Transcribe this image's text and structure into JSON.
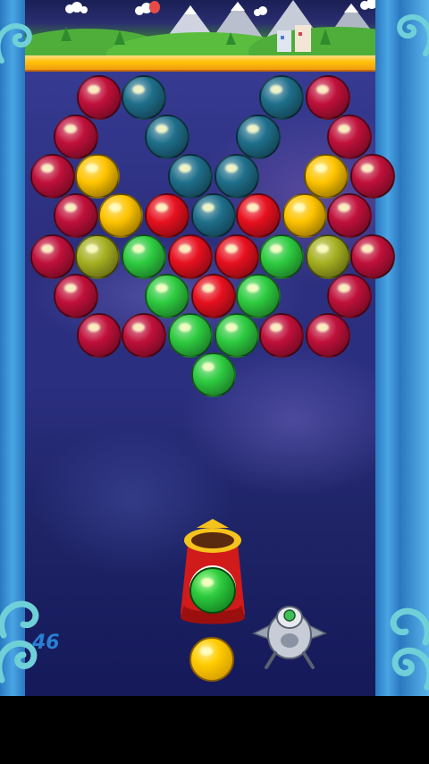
{
  "game": {
    "shots_remaining": "46",
    "current_bubble_color": "#2ecc40",
    "next_bubble_color": "#ffcc00"
  },
  "palette": {
    "red": "#e8101f",
    "magenta": "#c0103a",
    "teal": "#1f6f8b",
    "yellow": "#ffc400",
    "olive": "#a6b020",
    "green": "#2ecc40"
  },
  "board": {
    "rows": [
      [
        "magenta",
        "teal",
        null,
        null,
        "teal",
        "magenta"
      ],
      [
        "magenta",
        "teal",
        null,
        "teal",
        "magenta"
      ],
      [
        "magenta",
        "yellow",
        "teal",
        "teal",
        "yellow",
        "magenta"
      ],
      [
        "magenta",
        "yellow",
        "red",
        "teal",
        "red",
        "yellow",
        "magenta"
      ],
      [
        "magenta",
        "olive",
        "green",
        "red",
        "red",
        "green",
        "olive",
        "magenta"
      ],
      [
        "magenta",
        "green",
        "red",
        "green",
        "magenta"
      ],
      [
        "magenta",
        "magenta",
        "green",
        "green",
        "magenta",
        "magenta"
      ],
      [
        "green"
      ]
    ]
  }
}
